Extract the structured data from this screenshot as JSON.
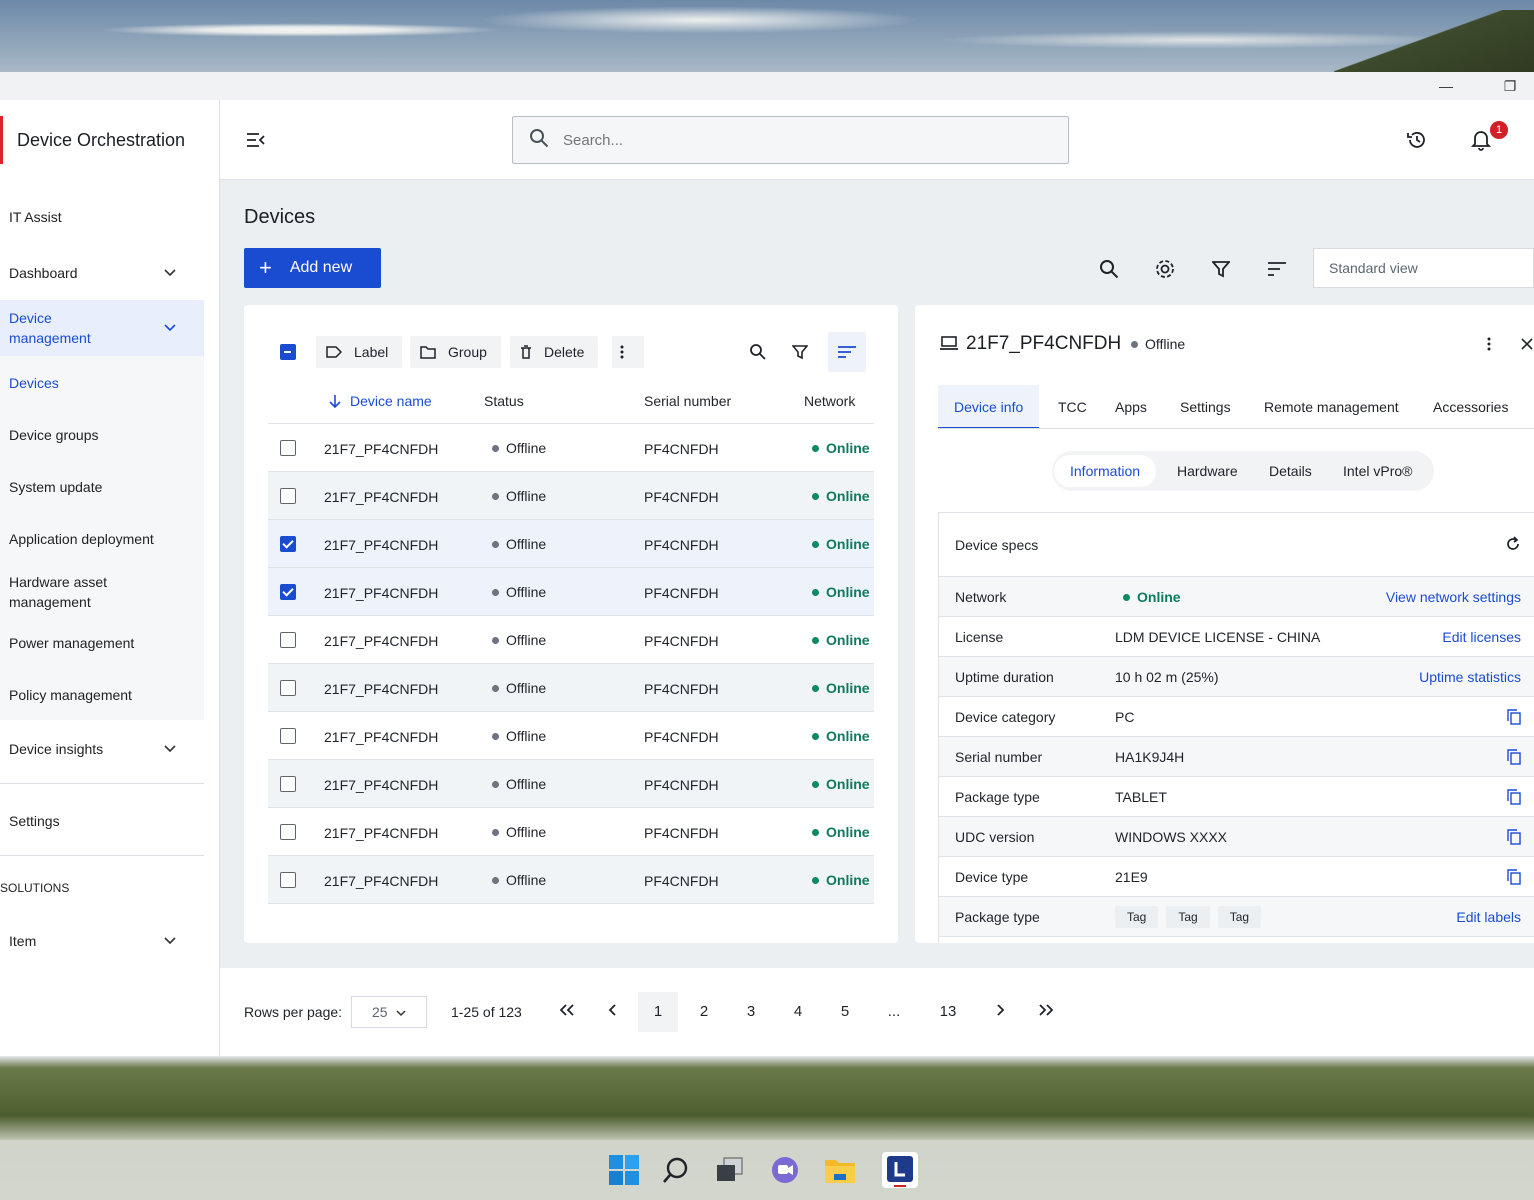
{
  "window": {
    "minimize_icon": "minimize-icon",
    "restore_icon": "restore-icon"
  },
  "app": {
    "title": "Device Orchestration"
  },
  "sidebar": {
    "items": [
      {
        "label": "IT Assist"
      },
      {
        "label": "Dashboard"
      },
      {
        "label": "Device management"
      },
      {
        "label": "Devices"
      },
      {
        "label": "Device groups"
      },
      {
        "label": "System update"
      },
      {
        "label": "Application deployment"
      },
      {
        "label": "Hardware asset management"
      },
      {
        "label": "Power management"
      },
      {
        "label": "Policy management"
      },
      {
        "label": "Device insights"
      },
      {
        "label": "Settings"
      }
    ],
    "section_label": "SOLUTIONS",
    "solution_item": "Item"
  },
  "search": {
    "placeholder": "Search..."
  },
  "notifications": {
    "count": "1"
  },
  "page": {
    "title": "Devices",
    "add_label": "Add new",
    "view_select": "Standard view"
  },
  "toolbar": {
    "label": "Label",
    "group": "Group",
    "delete": "Delete"
  },
  "table": {
    "columns": [
      "Device name",
      "Status",
      "Serial number",
      "Network"
    ],
    "rows": [
      {
        "name": "21F7_PF4CNFDH",
        "status": "Offline",
        "serial": "PF4CNFDH",
        "network": "Online",
        "checked": false
      },
      {
        "name": "21F7_PF4CNFDH",
        "status": "Offline",
        "serial": "PF4CNFDH",
        "network": "Online",
        "checked": false
      },
      {
        "name": "21F7_PF4CNFDH",
        "status": "Offline",
        "serial": "PF4CNFDH",
        "network": "Online",
        "checked": true
      },
      {
        "name": "21F7_PF4CNFDH",
        "status": "Offline",
        "serial": "PF4CNFDH",
        "network": "Online",
        "checked": true
      },
      {
        "name": "21F7_PF4CNFDH",
        "status": "Offline",
        "serial": "PF4CNFDH",
        "network": "Online",
        "checked": false
      },
      {
        "name": "21F7_PF4CNFDH",
        "status": "Offline",
        "serial": "PF4CNFDH",
        "network": "Online",
        "checked": false
      },
      {
        "name": "21F7_PF4CNFDH",
        "status": "Offline",
        "serial": "PF4CNFDH",
        "network": "Online",
        "checked": false
      },
      {
        "name": "21F7_PF4CNFDH",
        "status": "Offline",
        "serial": "PF4CNFDH",
        "network": "Online",
        "checked": false
      },
      {
        "name": "21F7_PF4CNFDH",
        "status": "Offline",
        "serial": "PF4CNFDH",
        "network": "Online",
        "checked": false
      },
      {
        "name": "21F7_PF4CNFDH",
        "status": "Offline",
        "serial": "PF4CNFDH",
        "network": "Online",
        "checked": false
      }
    ]
  },
  "detail": {
    "device_name": "21F7_PF4CNFDH",
    "status": "Offline",
    "tabs": [
      "Device info",
      "TCC",
      "Apps",
      "Settings",
      "Remote management",
      "Accessories"
    ],
    "subtabs": [
      "Information",
      "Hardware",
      "Details",
      "Intel vPro®"
    ],
    "specs_title": "Device specs",
    "specs": [
      {
        "key": "Network",
        "value": "Online",
        "action": "View network settings"
      },
      {
        "key": "License",
        "value": "LDM DEVICE LICENSE - CHINA",
        "action": "Edit licenses"
      },
      {
        "key": "Uptime duration",
        "value": "10 h 02 m (25%)",
        "action": "Uptime statistics"
      },
      {
        "key": "Device category",
        "value": "PC"
      },
      {
        "key": "Serial number",
        "value": "HA1K9J4H"
      },
      {
        "key": "Package type",
        "value": "TABLET"
      },
      {
        "key": "UDC version",
        "value": "WINDOWS XXXX"
      },
      {
        "key": "Device type",
        "value": "21E9"
      },
      {
        "key": "Package type",
        "tags": [
          "Tag",
          "Tag",
          "Tag"
        ],
        "action": "Edit labels"
      }
    ]
  },
  "pager": {
    "rows_label": "Rows per page:",
    "rows_value": "25",
    "range": "1-25 of 123",
    "pages": [
      "1",
      "2",
      "3",
      "4",
      "5",
      "...",
      "13"
    ]
  },
  "colors": {
    "accent": "#1a4cd2",
    "brand_red": "#d8262e",
    "online": "#0d7a5f",
    "offline": "#6b7480"
  }
}
